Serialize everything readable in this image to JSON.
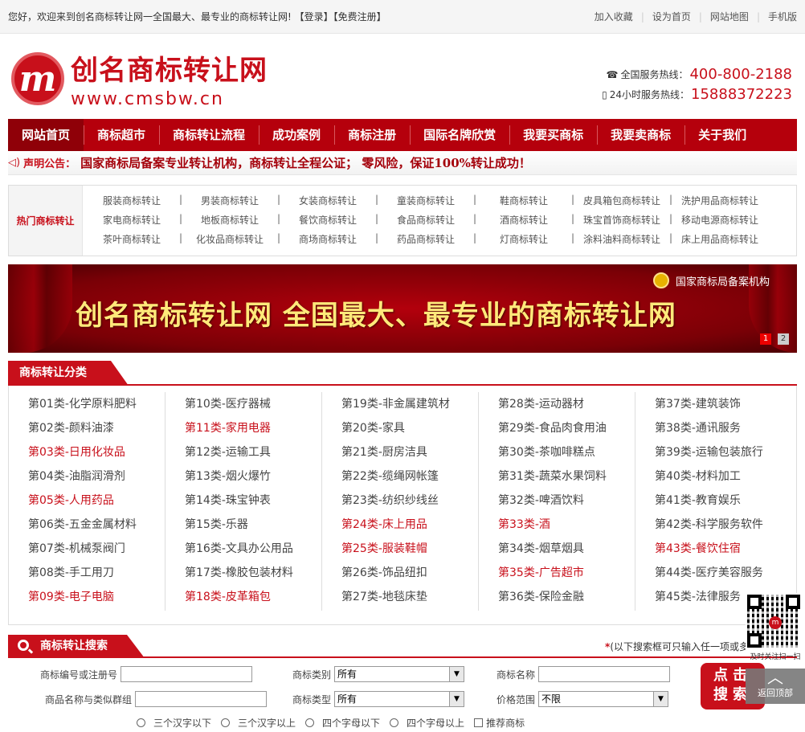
{
  "topbar": {
    "welcome": "您好，欢迎来到创名商标转让网一全国最大、最专业的商标转让网!",
    "login": "【登录】",
    "register": "【免费注册】",
    "links": [
      "加入收藏",
      "设为首页",
      "网站地图",
      "手机版"
    ]
  },
  "header": {
    "logo_mark": "m",
    "logo_cn": "创名商标转让网",
    "logo_en": "www.cmsbw.cn",
    "hotline1_label": "全国服务热线：",
    "hotline1": "400-800-2188",
    "hotline2_label": "24小时服务热线：",
    "hotline2": "15888372223"
  },
  "nav": [
    "网站首页",
    "商标超市",
    "商标转让流程",
    "成功案例",
    "商标注册",
    "国际名牌欣赏",
    "我要买商标",
    "我要卖商标",
    "关于我们"
  ],
  "notice": {
    "label": "声明公告：",
    "text": "国家商标局备案专业转让机构，商标转让全程公证； 零风险，保证100%转让成功！"
  },
  "hot": {
    "title": "热门商标转让",
    "rows": [
      [
        "服装商标转让",
        "男装商标转让",
        "女装商标转让",
        "童装商标转让",
        "鞋商标转让",
        "皮具箱包商标转让",
        "洗护用品商标转让"
      ],
      [
        "家电商标转让",
        "地板商标转让",
        "餐饮商标转让",
        "食品商标转让",
        "酒商标转让",
        "珠宝首饰商标转让",
        "移动电源商标转让"
      ],
      [
        "茶叶商标转让",
        "化妆品商标转让",
        "商场商标转让",
        "药品商标转让",
        "灯商标转让",
        "涂料油料商标转让",
        "床上用品商标转让"
      ]
    ]
  },
  "banner": {
    "title": "创名商标转让网  全国最大、最专业的商标转让网",
    "badge": "国家商标局备案机构",
    "pages": [
      "1",
      "2"
    ]
  },
  "categories": {
    "title": "商标转让分类",
    "columns": [
      [
        {
          "t": "第01类-化学原料肥料",
          "hl": false
        },
        {
          "t": "第02类-颜料油漆",
          "hl": false
        },
        {
          "t": "第03类-日用化妆品",
          "hl": true
        },
        {
          "t": "第04类-油脂润滑剂",
          "hl": false
        },
        {
          "t": "第05类-人用药品",
          "hl": true
        },
        {
          "t": "第06类-五金金属材料",
          "hl": false
        },
        {
          "t": "第07类-机械泵阀门",
          "hl": false
        },
        {
          "t": "第08类-手工用刀",
          "hl": false
        },
        {
          "t": "第09类-电子电脑",
          "hl": true
        }
      ],
      [
        {
          "t": "第10类-医疗器械",
          "hl": false
        },
        {
          "t": "第11类-家用电器",
          "hl": true
        },
        {
          "t": "第12类-运输工具",
          "hl": false
        },
        {
          "t": "第13类-烟火爆竹",
          "hl": false
        },
        {
          "t": "第14类-珠宝钟表",
          "hl": false
        },
        {
          "t": "第15类-乐器",
          "hl": false
        },
        {
          "t": "第16类-文具办公用品",
          "hl": false
        },
        {
          "t": "第17类-橡胶包装材料",
          "hl": false
        },
        {
          "t": "第18类-皮革箱包",
          "hl": true
        }
      ],
      [
        {
          "t": "第19类-非金属建筑材",
          "hl": false
        },
        {
          "t": "第20类-家具",
          "hl": false
        },
        {
          "t": "第21类-厨房洁具",
          "hl": false
        },
        {
          "t": "第22类-缆绳网帐篷",
          "hl": false
        },
        {
          "t": "第23类-纺织纱线丝",
          "hl": false
        },
        {
          "t": "第24类-床上用品",
          "hl": true
        },
        {
          "t": "第25类-服装鞋帽",
          "hl": true
        },
        {
          "t": "第26类-饰品纽扣",
          "hl": false
        },
        {
          "t": "第27类-地毯床垫",
          "hl": false
        }
      ],
      [
        {
          "t": "第28类-运动器材",
          "hl": false
        },
        {
          "t": "第29类-食品肉食用油",
          "hl": false
        },
        {
          "t": "第30类-茶咖啡糕点",
          "hl": false
        },
        {
          "t": "第31类-蔬菜水果饲料",
          "hl": false
        },
        {
          "t": "第32类-啤酒饮料",
          "hl": false
        },
        {
          "t": "第33类-酒",
          "hl": true
        },
        {
          "t": "第34类-烟草烟具",
          "hl": false
        },
        {
          "t": "第35类-广告超市",
          "hl": true
        },
        {
          "t": "第36类-保险金融",
          "hl": false
        }
      ],
      [
        {
          "t": "第37类-建筑装饰",
          "hl": false
        },
        {
          "t": "第38类-通讯服务",
          "hl": false
        },
        {
          "t": "第39类-运输包装旅行",
          "hl": false
        },
        {
          "t": "第40类-材料加工",
          "hl": false
        },
        {
          "t": "第41类-教育娱乐",
          "hl": false
        },
        {
          "t": "第42类-科学服务软件",
          "hl": false
        },
        {
          "t": "第43类-餐饮住宿",
          "hl": true
        },
        {
          "t": "第44类-医疗美容服务",
          "hl": false
        },
        {
          "t": "第45类-法律服务",
          "hl": false
        }
      ]
    ]
  },
  "search": {
    "title": "商标转让搜索",
    "note_star": "*",
    "note": "(以下搜索框可只输入任一项或多",
    "label_regno": "商标编号或注册号",
    "label_class": "商标类别",
    "class_value": "所有",
    "label_name": "商标名称",
    "label_goods": "商品名称与类似群组",
    "label_type": "商标类型",
    "type_value": "所有",
    "label_price": "价格范围",
    "price_value": "不限",
    "button": "点击搜索",
    "radios": [
      "三个汉字以下",
      "三个汉字以上",
      "四个字母以下",
      "四个字母以上"
    ],
    "checkbox": "推荐商标"
  },
  "float": {
    "qr_text": "及时关注扫一扫",
    "qr_mark": "m",
    "totop": "返回顶部"
  }
}
